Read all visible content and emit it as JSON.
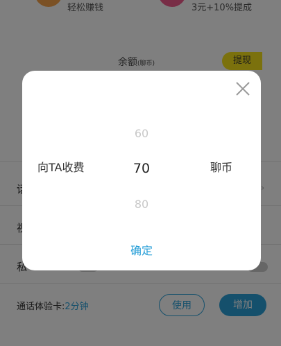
{
  "background": {
    "earn_caption": "轻松赚钱",
    "promo_caption": "3元+10%提成",
    "balance_label": "余额",
    "balance_unit": "(聊币)",
    "withdraw_button": "提现",
    "row_label_1": "话",
    "row_label_2": "视",
    "row_label_3": "私",
    "trial_prefix": "通话体验卡:",
    "trial_value": "2分钟",
    "use_button": "使用",
    "add_button": "增加"
  },
  "dialog": {
    "picker_left_label": "向TA收费",
    "picker_right_label": "聊币",
    "options": [
      "60",
      "70",
      "80"
    ],
    "selected": "70",
    "confirm_label": "确定"
  },
  "colors": {
    "accent": "#2aa0d8",
    "withdraw_bg": "#f6e21a",
    "overlay": "rgba(0,0,0,0.5)"
  }
}
